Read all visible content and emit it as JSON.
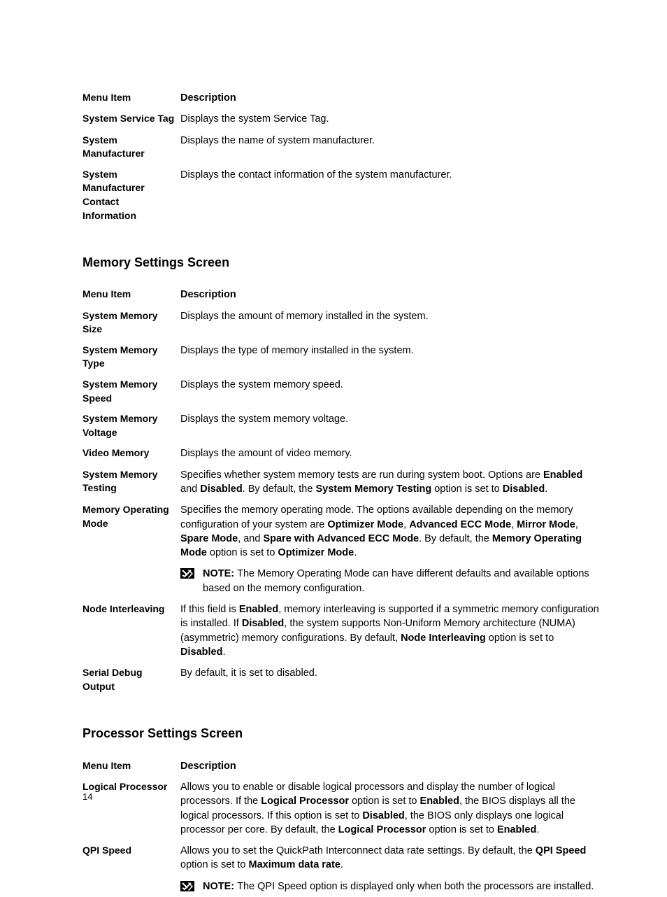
{
  "table1": {
    "header": {
      "menu": "Menu Item",
      "desc": "Description"
    },
    "rows": [
      {
        "menu": "System Service Tag",
        "desc": "Displays the system Service Tag."
      },
      {
        "menu": "System Manufacturer",
        "desc": "Displays the name of system manufacturer."
      },
      {
        "menu": "System Manufacturer Contact Information",
        "desc": "Displays the contact information of the system manufacturer."
      }
    ]
  },
  "heading_memory": "Memory Settings Screen",
  "table2": {
    "header": {
      "menu": "Menu Item",
      "desc": "Description"
    },
    "rows": {
      "r0": {
        "menu": "System Memory Size",
        "desc": "Displays the amount of memory installed in the system."
      },
      "r1": {
        "menu": "System Memory Type",
        "desc": "Displays the type of memory installed in the system."
      },
      "r2": {
        "menu": "System Memory Speed",
        "desc": "Displays the system memory speed."
      },
      "r3": {
        "menu": "System Memory Voltage",
        "desc": "Displays the system memory voltage."
      },
      "r4": {
        "menu": "Video Memory",
        "desc": "Displays the amount of video memory."
      },
      "r5": {
        "menu": "System Memory Testing",
        "t1": "Specifies whether system memory tests are run during system boot. Options are ",
        "b1": "Enabled",
        "t2": " and ",
        "b2": "Disabled",
        "t3": ". By default, the ",
        "b3": "System Memory Testing",
        "t4": " option is set to ",
        "b4": "Disabled",
        "t5": "."
      },
      "r6": {
        "menu": "Memory Operating Mode",
        "t1": "Specifies the memory operating mode. The options available depending on the memory configuration of your system are ",
        "b1": "Optimizer Mode",
        "t2": ", ",
        "b2": "Advanced ECC Mode",
        "t3": ", ",
        "b3": "Mirror Mode",
        "t4": ", ",
        "b4": "Spare Mode",
        "t5": ", and ",
        "b5": "Spare with Advanced ECC Mode",
        "t6": ". By default, the ",
        "b6": "Memory Operating Mode",
        "t7": " option is set to ",
        "b7": "Optimizer Mode",
        "t8": ".",
        "note_b": "NOTE: ",
        "note_t": "The Memory Operating Mode can have different defaults and available options based on the memory configuration."
      },
      "r7": {
        "menu": "Node Interleaving",
        "t1": "If this field is ",
        "b1": "Enabled",
        "t2": ", memory interleaving is supported if a symmetric memory configuration is installed. If ",
        "b2": "Disabled",
        "t3": ", the system supports Non-Uniform Memory architecture (NUMA) (asymmetric) memory configurations. By default, ",
        "b3": "Node Interleaving",
        "t4": " option is set to ",
        "b4": "Disabled",
        "t5": "."
      },
      "r8": {
        "menu": "Serial Debug Output",
        "desc": "By default, it is set to disabled."
      }
    }
  },
  "heading_processor": "Processor Settings Screen",
  "table3": {
    "header": {
      "menu": "Menu Item",
      "desc": "Description"
    },
    "rows": {
      "r0": {
        "menu": "Logical Processor",
        "t1": "Allows you to enable or disable logical processors and display the number of logical processors. If the ",
        "b1": "Logical Processor",
        "t2": " option is set to ",
        "b2": "Enabled",
        "t3": ", the BIOS displays all the logical processors. If this option is set to ",
        "b3": "Disabled",
        "t4": ", the BIOS only displays one logical processor per core. By default, the ",
        "b4": "Logical Processor",
        "t5": " option is set to ",
        "b5": "Enabled",
        "t6": "."
      },
      "r1": {
        "menu": "QPI Speed",
        "t1": "Allows you to set the QuickPath Interconnect data rate settings. By default, the ",
        "b1": "QPI Speed",
        "t2": " option is set to ",
        "b2": "Maximum data rate",
        "t3": ".",
        "note_b": "NOTE: ",
        "note_t": "The QPI Speed option is displayed only when both the processors are installed."
      }
    }
  },
  "page_number": "14"
}
